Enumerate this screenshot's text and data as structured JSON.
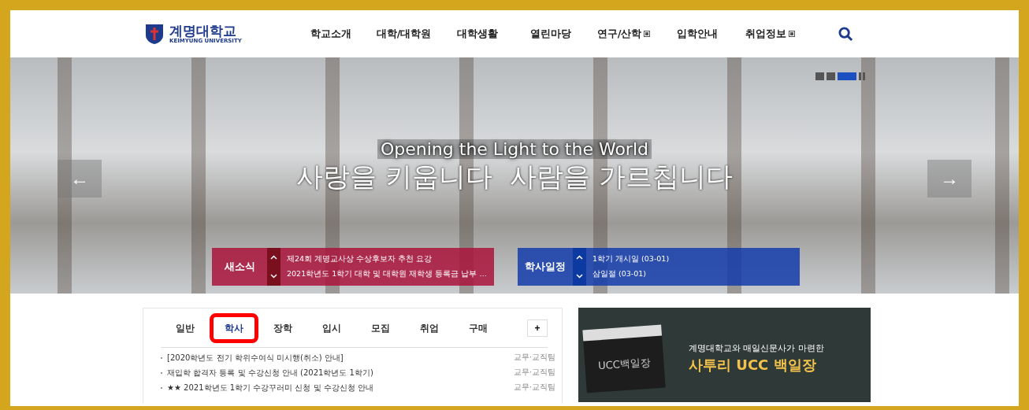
{
  "header": {
    "logo": {
      "name": "계명대학교",
      "subtitle": "KEIMYUNG UNIVERSITY"
    },
    "nav": [
      {
        "label": "학교소개",
        "external": false
      },
      {
        "label": "대학/대학원",
        "external": false
      },
      {
        "label": "대학생활",
        "external": false
      },
      {
        "label": "열린마당",
        "external": false
      },
      {
        "label": "연구/산학",
        "external": true
      },
      {
        "label": "입학안내",
        "external": false
      },
      {
        "label": "취업정보",
        "external": true
      }
    ]
  },
  "hero": {
    "slides": [
      {
        "selected": false
      },
      {
        "selected": false
      },
      {
        "selected": true
      }
    ],
    "tagline": "Opening the Light to the World",
    "headline": "사랑을 키웁니다  사람을 가르칩니다",
    "prev": "←",
    "next": "→"
  },
  "tickers": [
    {
      "kind": "news",
      "title": "새소식",
      "items": [
        "제24회 계명교사상 수상후보자 추천 요강",
        "2021학년도 1학기 대학 및 대학원 재학생 등록금 납부 …"
      ]
    },
    {
      "kind": "schedule",
      "title": "학사일정",
      "items": [
        "1학기 개시일 (03-01)",
        "삼일절 (03-01)"
      ]
    }
  ],
  "notices": {
    "tabs": [
      {
        "label": "일반",
        "selected": false
      },
      {
        "label": "학사",
        "selected": true
      },
      {
        "label": "장학",
        "selected": false
      },
      {
        "label": "입시",
        "selected": false
      },
      {
        "label": "모집",
        "selected": false
      },
      {
        "label": "취업",
        "selected": false
      },
      {
        "label": "구매",
        "selected": false
      }
    ],
    "more": "+",
    "rows": [
      {
        "title": "[2020학년도 전기 학위수여식 미시행(취소) 안내]",
        "dept": "교무·교직팀"
      },
      {
        "title": "재입학 합격자 등록 및 수강신청 안내 (2021학년도 1학기)",
        "dept": "교무·교직팀"
      },
      {
        "title": "★★ 2021학년도 1학기 수강꾸러미 신청 및 수강신청 안내",
        "dept": "교무·교직팀"
      }
    ]
  },
  "banner": {
    "subtitle": "계명대학교와 매일신문사가 마련한",
    "title": "사투리 UCC 백일장",
    "board": "UCC백일장"
  }
}
